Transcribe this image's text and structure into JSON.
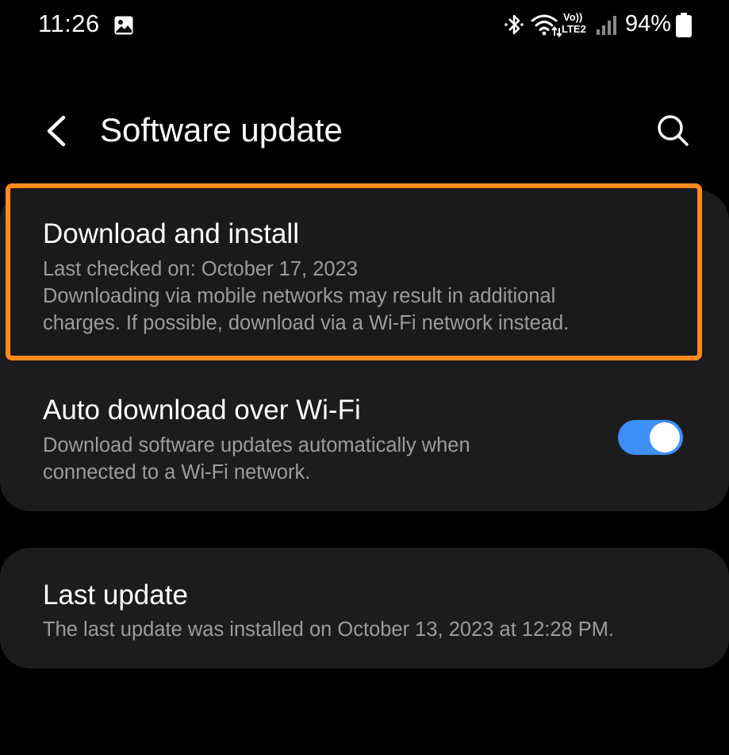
{
  "status_bar": {
    "time": "11:26",
    "battery_percent": "94%",
    "volte_label_top": "Vo))",
    "volte_label_bottom": "LTE2",
    "icons": [
      "gallery-icon",
      "bluetooth-icon",
      "wifi-icon",
      "volte-icon",
      "signal-icon",
      "battery-icon"
    ]
  },
  "header": {
    "title": "Software update",
    "back_icon": "chevron-left-icon",
    "search_icon": "search-icon"
  },
  "settings": {
    "download": {
      "title": "Download and install",
      "subtitle_line1": "Last checked on: October 17, 2023",
      "subtitle_line2": "Downloading via mobile networks may result in additional",
      "subtitle_line3": "charges. If possible, download via a Wi-Fi network instead."
    },
    "auto_download": {
      "title": "Auto download over Wi-Fi",
      "subtitle_line1": "Download software updates automatically when",
      "subtitle_line2": "connected to a Wi-Fi network.",
      "enabled": true
    },
    "last_update": {
      "title": "Last update",
      "subtitle": "The last update was installed on October 13, 2023 at 12:28 PM."
    }
  },
  "colors": {
    "background": "#000000",
    "card": "#1c1c1e",
    "highlight_border": "#ff8a1d",
    "toggle_on": "#3e8ef7",
    "subtitle_text": "#9c9c9c"
  }
}
